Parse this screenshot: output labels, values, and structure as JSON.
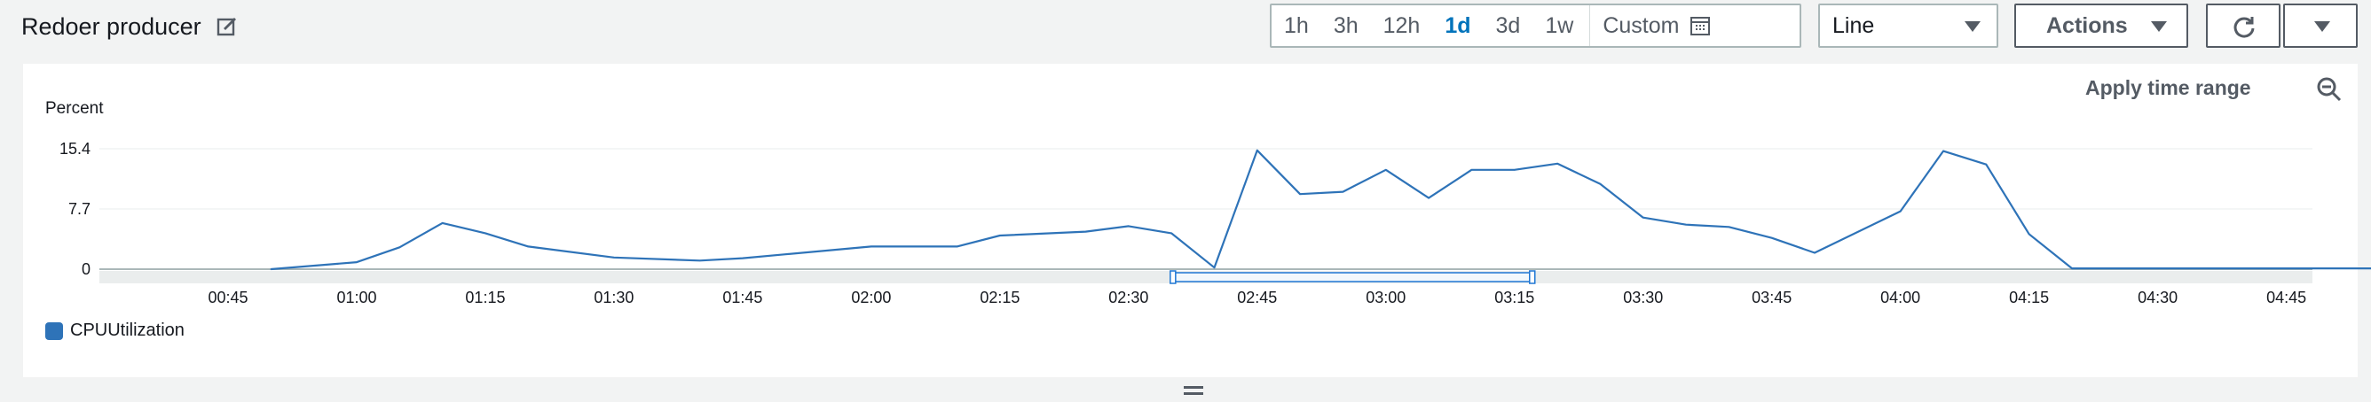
{
  "header": {
    "title": "Redoer producer",
    "time_ranges": [
      "1h",
      "3h",
      "12h",
      "1d",
      "3d",
      "1w"
    ],
    "active_range": "1d",
    "custom_label": "Custom",
    "view_select": "Line",
    "actions_label": "Actions"
  },
  "panel": {
    "apply_label": "Apply time range",
    "legend_label": "CPUUtilization"
  },
  "colors": {
    "series": "#2e73b8",
    "accent": "#0073bb",
    "brush": "#1f77d4"
  },
  "icons": [
    "edit-icon",
    "calendar-icon",
    "caret-down-icon",
    "refresh-icon",
    "zoom-out-icon",
    "drag-handle-icon"
  ],
  "chart_data": {
    "type": "line",
    "ylabel": "Percent",
    "yticks": [
      "0",
      "7.7",
      "15.4"
    ],
    "ylim": [
      0,
      15.4
    ],
    "xticks": [
      "00:45",
      "01:00",
      "01:15",
      "01:30",
      "01:45",
      "02:00",
      "02:15",
      "02:30",
      "02:45",
      "03:00",
      "03:15",
      "03:30",
      "03:45",
      "04:00",
      "04:15",
      "04:30",
      "04:45"
    ],
    "xlim_minutes_from_tick0": [
      -15,
      300
    ],
    "grid": true,
    "legend_position": "bottom-left",
    "series": [
      {
        "name": "CPUUtilization",
        "points": [
          [
            5,
            0
          ],
          [
            15,
            0.9
          ],
          [
            20,
            2.8
          ],
          [
            25,
            5.9
          ],
          [
            30,
            4.6
          ],
          [
            35,
            2.9
          ],
          [
            45,
            1.5
          ],
          [
            55,
            1.1
          ],
          [
            60,
            1.4
          ],
          [
            65,
            1.9
          ],
          [
            75,
            2.9
          ],
          [
            85,
            2.9
          ],
          [
            90,
            4.3
          ],
          [
            100,
            4.8
          ],
          [
            105,
            5.5
          ],
          [
            110,
            4.6
          ],
          [
            115,
            0.2
          ],
          [
            120,
            15.2
          ],
          [
            125,
            9.6
          ],
          [
            130,
            9.9
          ],
          [
            135,
            12.7
          ],
          [
            140,
            9.1
          ],
          [
            145,
            12.7
          ],
          [
            150,
            12.7
          ],
          [
            155,
            13.5
          ],
          [
            160,
            10.9
          ],
          [
            165,
            6.6
          ],
          [
            170,
            5.7
          ],
          [
            175,
            5.4
          ],
          [
            180,
            4.0
          ],
          [
            185,
            2.1
          ],
          [
            195,
            7.4
          ],
          [
            200,
            15.1
          ],
          [
            205,
            13.4
          ],
          [
            210,
            4.5
          ],
          [
            215,
            0.1
          ],
          [
            255,
            0.1
          ],
          [
            300,
            0.1
          ]
        ]
      }
    ],
    "selection_range_minutes": [
      105,
      150
    ]
  }
}
